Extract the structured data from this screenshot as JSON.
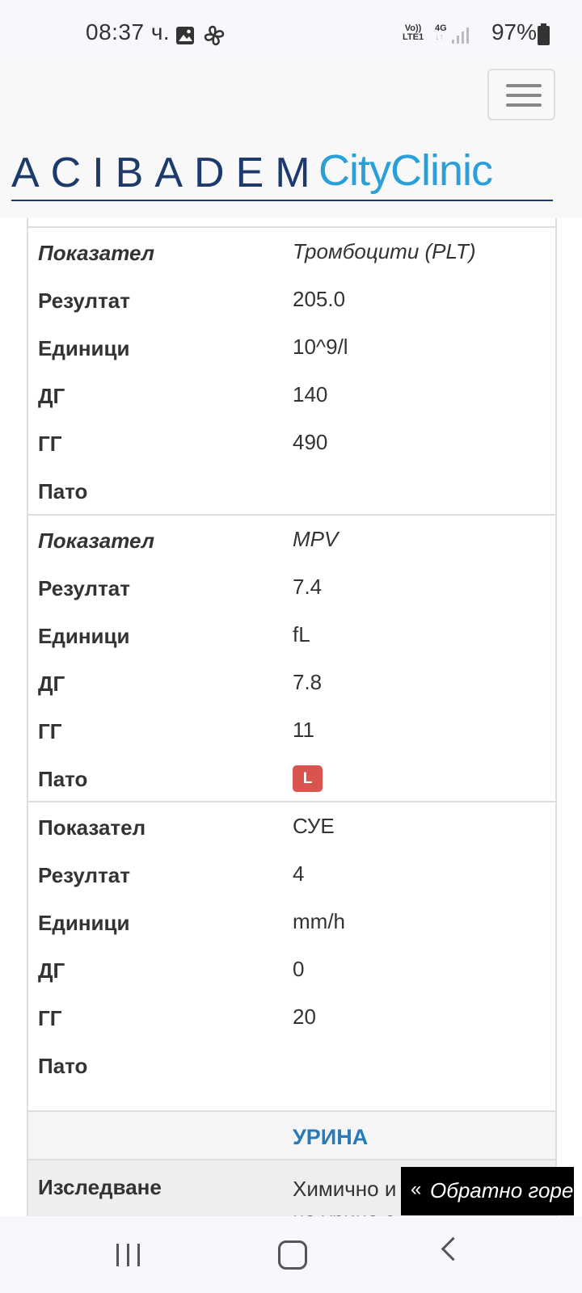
{
  "status_bar": {
    "time": "08:37 ч.",
    "network_top": "Vo))",
    "network_bottom": "LTE1",
    "data_type": "4G",
    "battery": "97%",
    "icons": [
      "image-icon",
      "fan-icon",
      "signal-icon",
      "battery-icon"
    ]
  },
  "header": {
    "logo_left": "ACIBADEM",
    "logo_right": "CityClinic",
    "menu_icon": "hamburger-menu-icon",
    "brand_colors": {
      "dark": "#1c3a6b",
      "light": "#2a9fd8"
    }
  },
  "table": {
    "blocks": [
      {
        "italic": true,
        "rows": [
          {
            "label": "Показател",
            "value": "Тромбоцити (PLT)"
          },
          {
            "label": "Резултат",
            "value": "205.0"
          },
          {
            "label": "Единици",
            "value": "10^9/l"
          },
          {
            "label": "ДГ",
            "value": "140"
          },
          {
            "label": "ГГ",
            "value": "490"
          },
          {
            "label": "Пато",
            "value": ""
          }
        ]
      },
      {
        "italic": true,
        "rows": [
          {
            "label": "Показател",
            "value": "MPV"
          },
          {
            "label": "Резултат",
            "value": "7.4"
          },
          {
            "label": "Единици",
            "value": "fL"
          },
          {
            "label": "ДГ",
            "value": "7.8"
          },
          {
            "label": "ГГ",
            "value": "11"
          },
          {
            "label": "Пато",
            "value": "L"
          }
        ]
      },
      {
        "italic": false,
        "rows": [
          {
            "label": "Показател",
            "value": "СУЕ"
          },
          {
            "label": "Резултат",
            "value": "4"
          },
          {
            "label": "Единици",
            "value": "mm/h"
          },
          {
            "label": "ДГ",
            "value": "0"
          },
          {
            "label": "ГГ",
            "value": "20"
          },
          {
            "label": "Пато",
            "value": ""
          }
        ]
      }
    ],
    "badge_color": "#d9534f",
    "section_title": "УРИНА",
    "study_label": "Изследване",
    "study_value_line1": "Химично и",
    "study_value_line2": "на урина с"
  },
  "back_to_top": "Обратно горе",
  "nav": [
    "recent-apps-button",
    "home-button",
    "back-button"
  ]
}
